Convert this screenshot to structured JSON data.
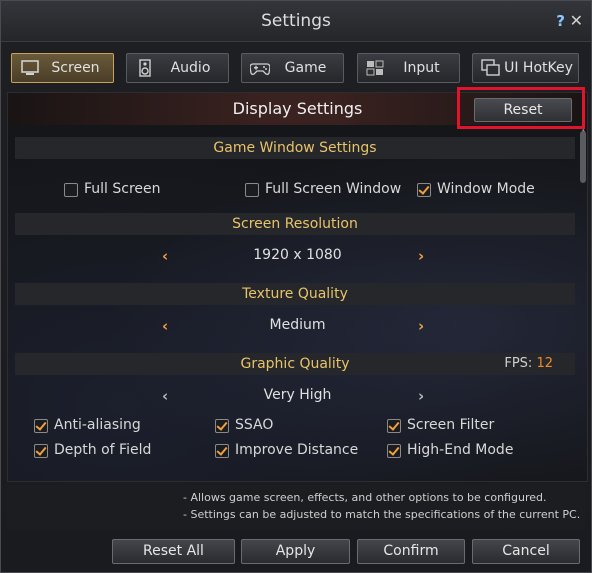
{
  "window": {
    "title": "Settings",
    "help_icon": "?",
    "close_icon": "✕"
  },
  "tabs": [
    {
      "label": "Screen",
      "icon": "monitor-icon",
      "active": true
    },
    {
      "label": "Audio",
      "icon": "speaker-icon",
      "active": false
    },
    {
      "label": "Game",
      "icon": "gamepad-icon",
      "active": false
    },
    {
      "label": "Input",
      "icon": "keyboard-icon",
      "active": false
    },
    {
      "label": "UI HotKey",
      "icon": "windows-icon",
      "active": false
    }
  ],
  "display": {
    "title": "Display Settings",
    "reset_label": "Reset"
  },
  "game_window": {
    "title": "Game Window Settings",
    "options": [
      {
        "label": "Full Screen",
        "checked": false
      },
      {
        "label": "Full Screen Window",
        "checked": false
      },
      {
        "label": "Window Mode",
        "checked": true
      }
    ]
  },
  "resolution": {
    "title": "Screen Resolution",
    "value": "1920 x 1080"
  },
  "texture": {
    "title": "Texture Quality",
    "value": "Medium"
  },
  "graphic": {
    "title": "Graphic Quality",
    "fps_label": "FPS:",
    "fps_value": "12",
    "value": "Very High",
    "options": [
      {
        "label": "Anti-aliasing",
        "checked": true
      },
      {
        "label": "SSAO",
        "checked": true
      },
      {
        "label": "Screen Filter",
        "checked": true
      },
      {
        "label": "Depth of Field",
        "checked": true
      },
      {
        "label": "Improve Distance",
        "checked": true
      },
      {
        "label": "High-End Mode",
        "checked": true
      }
    ]
  },
  "notes": [
    "- Allows game screen, effects, and other options to be configured.",
    "- Settings can be adjusted to match the specifications of the current PC."
  ],
  "footer": {
    "reset_all": "Reset All",
    "apply": "Apply",
    "confirm": "Confirm",
    "cancel": "Cancel"
  },
  "colors": {
    "accent": "#f0a040",
    "section_title": "#e8c36a",
    "highlight": "#e0142a",
    "fps_value": "#f08a2a"
  }
}
